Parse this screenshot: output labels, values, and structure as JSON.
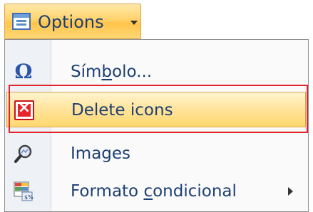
{
  "options_button": {
    "label": "Options",
    "icon": "options-menu-icon",
    "caret": "dropdown-arrow-icon"
  },
  "menu": {
    "items": [
      {
        "label_pre": "Sím",
        "label_ul": "b",
        "label_post": "olo...",
        "icon": "omega-icon",
        "highlighted": false
      },
      {
        "label": "Delete icons",
        "icon": "delete-icon",
        "highlighted": true
      },
      {
        "label": "Images",
        "icon": "magnifier-icon",
        "highlighted": false
      },
      {
        "label_pre": "Formato ",
        "label_ul": "c",
        "label_post": "ondicional",
        "icon": "conditional-format-icon",
        "submenu": true,
        "highlighted": false
      }
    ],
    "highlight_color": "#ffd86f",
    "annotation_color": "#e0262c"
  }
}
